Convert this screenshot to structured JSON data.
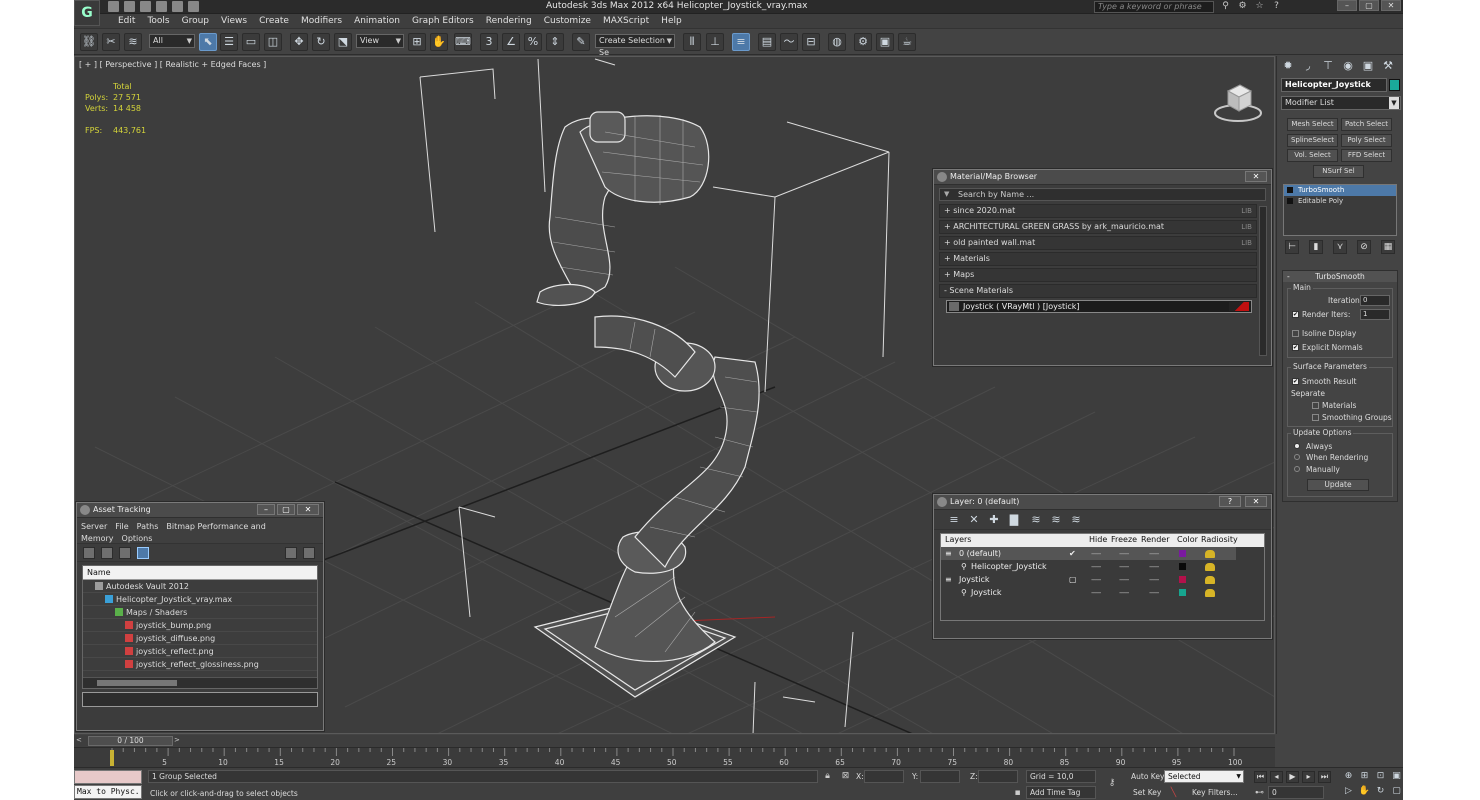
{
  "titlebar": {
    "app_title": "Autodesk 3ds Max  2012 x64      Helicopter_Joystick_vray.max",
    "search_placeholder": "Type a keyword or phrase",
    "logo_glyph": "G"
  },
  "menu": [
    "Edit",
    "Tools",
    "Group",
    "Views",
    "Create",
    "Modifiers",
    "Animation",
    "Graph Editors",
    "Rendering",
    "Customize",
    "MAXScript",
    "Help"
  ],
  "toolbar": {
    "selection_filter": "All",
    "ref_coord": "View",
    "named_selection": "Create Selection Se"
  },
  "viewport": {
    "label": "[ + ] [ Perspective ] [ Realistic + Edged Faces ]",
    "stats": {
      "total_label": "Total",
      "polys_label": "Polys:",
      "polys_value": "27 571",
      "verts_label": "Verts:",
      "verts_value": "14 458",
      "fps_label": "FPS:",
      "fps_value": "443,761"
    }
  },
  "material_browser": {
    "title": "Material/Map Browser",
    "search_placeholder": "Search by Name ...",
    "close": "✕",
    "rows": [
      {
        "label": "+ since 2020.mat",
        "lib": "LIB"
      },
      {
        "label": "+ ARCHITECTURAL GREEN GRASS by ark_mauricio.mat",
        "lib": "LIB"
      },
      {
        "label": "+ old painted wall.mat",
        "lib": "LIB"
      },
      {
        "label": "+ Materials",
        "lib": ""
      },
      {
        "label": "+ Maps",
        "lib": ""
      },
      {
        "label": "- Scene Materials",
        "lib": ""
      }
    ],
    "scene_material": "Joystick  ( VRayMtl )  [Joystick]"
  },
  "asset_tracking": {
    "title": "Asset Tracking",
    "menu": [
      "Server",
      "File",
      "Paths",
      "Bitmap Performance and Memory",
      "Options"
    ],
    "column_header": "Name",
    "tree": [
      {
        "label": "Autodesk Vault 2012",
        "indent": 1
      },
      {
        "label": "Helicopter_Joystick_vray.max",
        "indent": 2
      },
      {
        "label": "Maps / Shaders",
        "indent": 3
      },
      {
        "label": "joystick_bump.png",
        "indent": 4
      },
      {
        "label": "joystick_diffuse.png",
        "indent": 4
      },
      {
        "label": "joystick_reflect.png",
        "indent": 4
      },
      {
        "label": "joystick_reflect_glossiness.png",
        "indent": 4
      }
    ]
  },
  "layer_panel": {
    "title": "Layer: 0 (default)",
    "help": "?",
    "close": "✕",
    "columns": [
      "Layers",
      "Hide",
      "Freeze",
      "Render",
      "Color",
      "Radiosity"
    ],
    "rows": [
      {
        "name": "0 (default)",
        "indent": 0,
        "color": "#7a1aa0",
        "active": "✔"
      },
      {
        "name": "Helicopter_Joystick",
        "indent": 1,
        "color": "#0a0a0a",
        "active": ""
      },
      {
        "name": "Joystick",
        "indent": 0,
        "color": "#b3114b",
        "active": "▢"
      },
      {
        "name": "Joystick",
        "indent": 1,
        "color": "#17a58f",
        "active": ""
      }
    ],
    "dots": "-----"
  },
  "command_panel": {
    "object_name": "Helicopter_Joystick",
    "object_color": "#1aa99a",
    "modifier_list": "Modifier List",
    "mod_buttons": [
      "Mesh Select",
      "Patch Select",
      "SplineSelect",
      "Poly Select",
      "Vol. Select",
      "FFD Select",
      "NSurf Sel"
    ],
    "stack": [
      {
        "label": "TurboSmooth",
        "selected": true
      },
      {
        "label": "Editable Poly",
        "selected": false
      }
    ],
    "turbosmooth": {
      "title": "TurboSmooth",
      "main_label": "Main",
      "iterations_label": "Iterations:",
      "iterations_value": "0",
      "render_iters_label": "Render Iters:",
      "render_iters_value": "1",
      "isoline_label": "Isoline Display",
      "explicit_label": "Explicit Normals",
      "surface_label": "Surface Parameters",
      "smooth_result_label": "Smooth Result",
      "separate_label": "Separate",
      "materials_label": "Materials",
      "smoothing_groups_label": "Smoothing Groups",
      "update_options_label": "Update Options",
      "always_label": "Always",
      "when_rendering_label": "When Rendering",
      "manually_label": "Manually",
      "update_button": "Update",
      "check": "✔"
    }
  },
  "timeline": {
    "frame_display": "0 / 100",
    "ticks": [
      "5",
      "10",
      "15",
      "20",
      "25",
      "30",
      "35",
      "40",
      "45",
      "50",
      "55",
      "60",
      "65",
      "70",
      "75",
      "80",
      "85",
      "90",
      "95",
      "100"
    ]
  },
  "statusbar": {
    "selection_status": "1 Group Selected",
    "prompt": "Click or click-and-drag to select objects",
    "listener_text": "Max to Physc.",
    "x_label": "X:",
    "y_label": "Y:",
    "z_label": "Z:",
    "grid": "Grid = 10,0",
    "add_time_tag": "Add Time Tag",
    "auto_key": "Auto Key",
    "set_key": "Set Key",
    "key_filters": "Key Filters...",
    "selected_dropdown": "Selected",
    "frame_field": "0"
  }
}
